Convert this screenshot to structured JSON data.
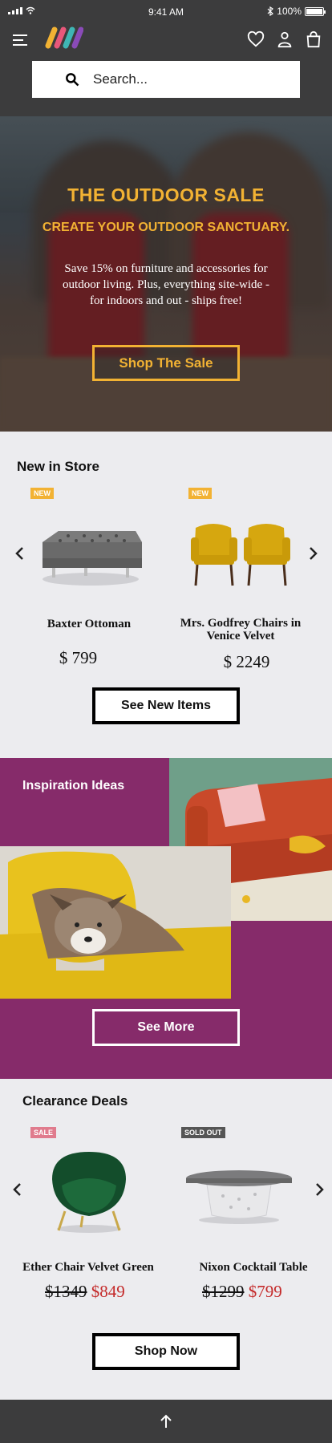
{
  "status_bar": {
    "time": "9:41 AM",
    "battery": "100%"
  },
  "header": {
    "search": {
      "placeholder": "Search..."
    },
    "icons": [
      "menu-icon",
      "logo",
      "heart-icon",
      "user-icon",
      "bag-icon"
    ]
  },
  "hero": {
    "title": "THE OUTDOOR SALE",
    "subtitle": "CREATE YOUR OUTDOOR SANCTUARY.",
    "body": "Save 15% on furniture  and accessories for outdoor living. Plus, everything site-wide - for indoors and out - ships free!",
    "cta": "Shop The Sale",
    "accent_color": "#f2b233"
  },
  "new_in_store": {
    "title": "New in Store",
    "items": [
      {
        "badge": "NEW",
        "name": "Baxter Ottoman",
        "price": "$ 799"
      },
      {
        "badge": "NEW",
        "name": "Mrs. Godfrey Chairs in Venice Velvet",
        "price": "$ 2249"
      }
    ],
    "cta": "See New Items"
  },
  "inspiration": {
    "title": "Inspiration Ideas",
    "cta": "See More",
    "bg_color": "#862b6a"
  },
  "clearance": {
    "title": "Clearance Deals",
    "items": [
      {
        "badge": "SALE",
        "name": "Ether Chair Velvet Green",
        "old_price": "$1349",
        "new_price": "$849"
      },
      {
        "badge": "SOLD OUT",
        "name": "Nixon Cocktail Table",
        "old_price": "$1299",
        "new_price": "$799"
      }
    ],
    "cta": "Shop Now"
  },
  "footer": {
    "icon": "arrow-up-icon"
  }
}
